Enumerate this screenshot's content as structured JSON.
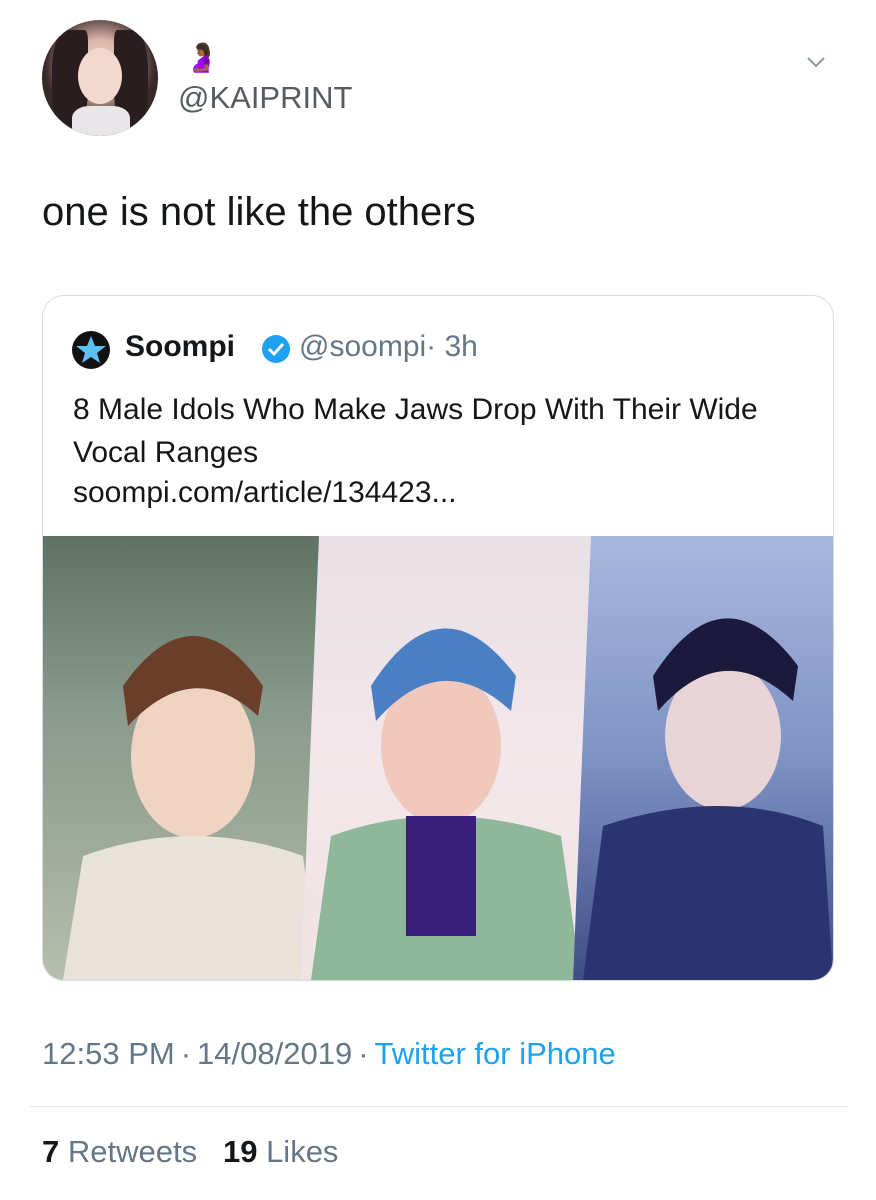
{
  "author": {
    "handle": "@KAIPRINT",
    "emoji": "🤰🏾"
  },
  "tweet": {
    "text": "one is not like the others"
  },
  "quoted_tweet": {
    "name": "Soompi",
    "handle": "@soompi",
    "time": "· 3h",
    "headline": "8 Male Idols Who Make Jaws Drop With Their Wide Vocal Ranges",
    "link": "soompi.com/article/134423...",
    "verified": true
  },
  "footer": {
    "time": "12:53 PM",
    "date": "14/08/2019",
    "source": "Twitter for iPhone",
    "sep1": "·",
    "sep2": "·"
  },
  "stats": {
    "retweets_count": "7",
    "retweets_label": "Retweets",
    "likes_count": "19",
    "likes_label": "Likes"
  },
  "colors": {
    "accent": "#1da1f2",
    "secondary_text": "#657786",
    "primary_text": "#14171a"
  }
}
